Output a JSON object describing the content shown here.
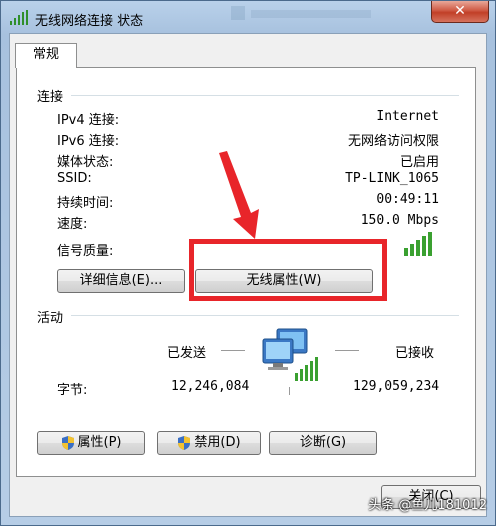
{
  "window": {
    "title": "无线网络连接 状态",
    "close_symbol": "✕"
  },
  "tabs": [
    {
      "label": "常规"
    }
  ],
  "connection": {
    "group_label": "连接",
    "rows": [
      {
        "label": "IPv4 连接:",
        "value": "Internet"
      },
      {
        "label": "IPv6 连接:",
        "value": "无网络访问权限"
      },
      {
        "label": "媒体状态:",
        "value": "已启用"
      },
      {
        "label": "SSID:",
        "value": "TP-LINK_1065"
      },
      {
        "label": "持续时间:",
        "value": "00:49:11"
      },
      {
        "label": "速度:",
        "value": "150.0 Mbps"
      }
    ],
    "signal_label": "信号质量:",
    "signal_bars": 5,
    "details_button": "详细信息(E)...",
    "wireless_props_button": "无线属性(W)"
  },
  "activity": {
    "group_label": "活动",
    "sent_label": "已发送",
    "received_label": "已接收",
    "bytes_label": "字节:",
    "bytes_sent": "12,246,084",
    "bytes_received": "129,059,234"
  },
  "buttons": {
    "properties": "属性(P)",
    "disable": "禁用(D)",
    "diagnose": "诊断(G)",
    "close": "关闭(C)"
  },
  "watermark": "头条 @鱼儿181012",
  "colors": {
    "highlight_box": "#e8252a",
    "signal_green": "#3aa030"
  }
}
